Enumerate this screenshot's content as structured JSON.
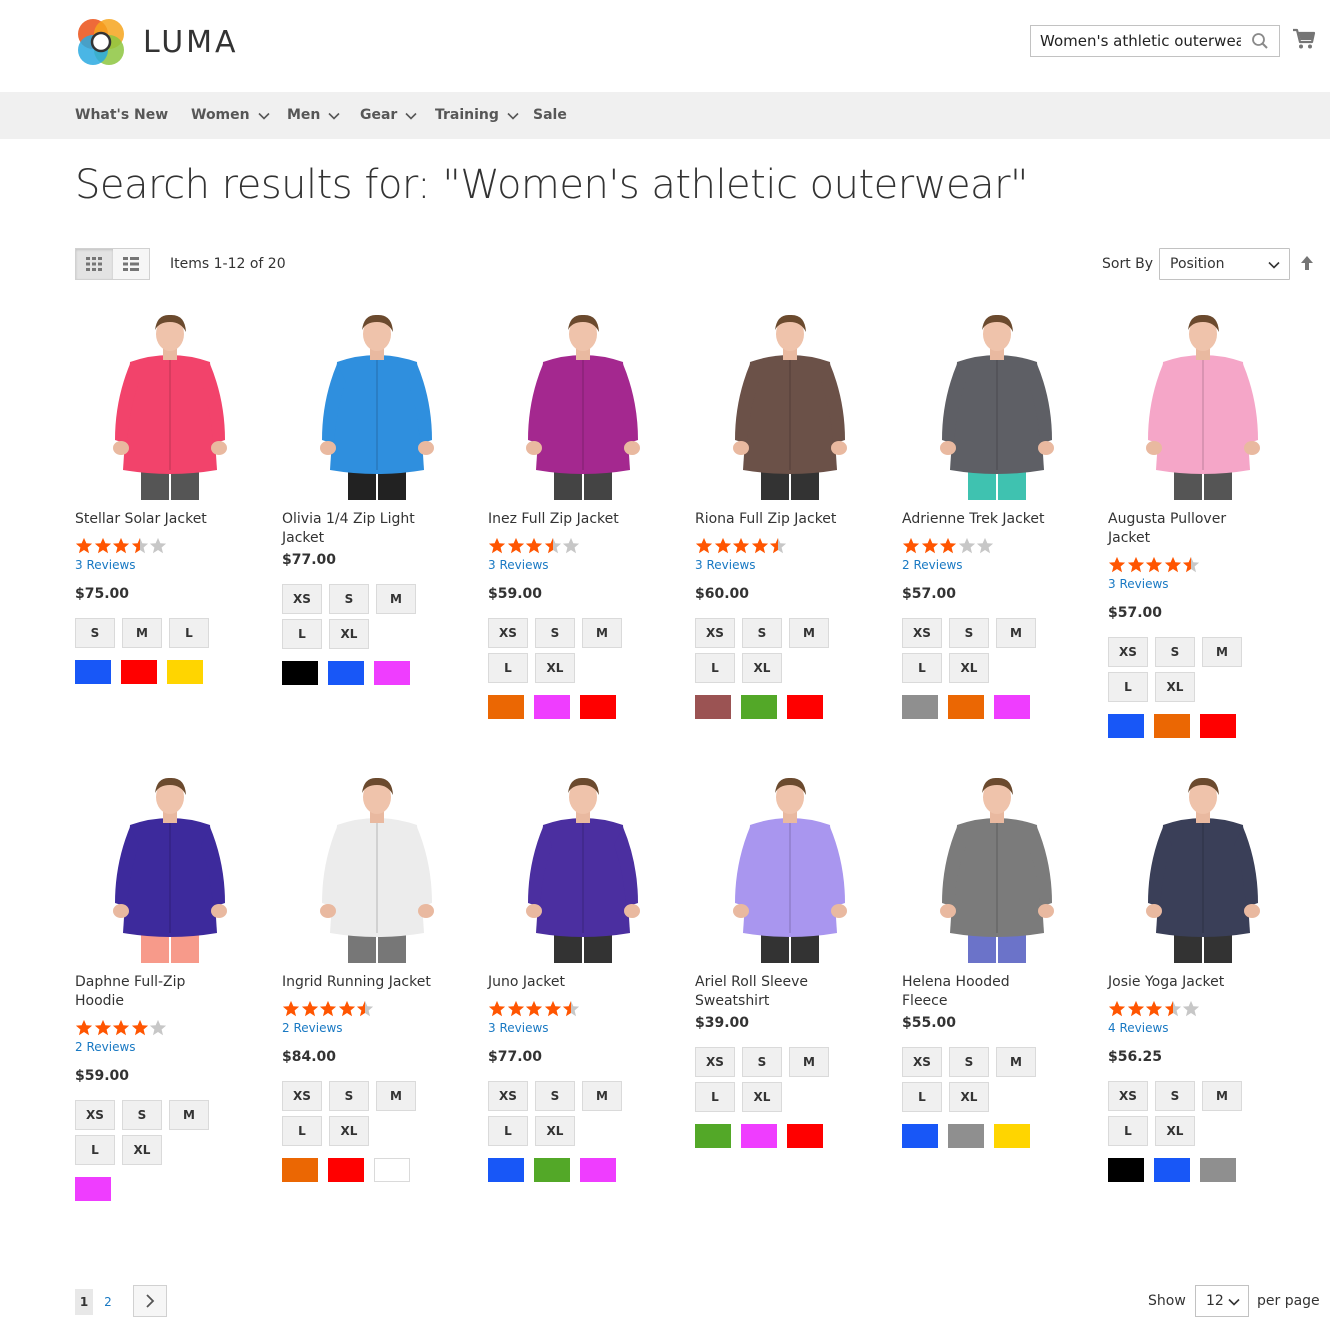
{
  "brand": {
    "name": "LUMA"
  },
  "search": {
    "value": "Women's athletic outerwear"
  },
  "nav": [
    {
      "label": "What's New",
      "has_dropdown": false
    },
    {
      "label": "Women",
      "has_dropdown": true
    },
    {
      "label": "Men",
      "has_dropdown": true
    },
    {
      "label": "Gear",
      "has_dropdown": true
    },
    {
      "label": "Training",
      "has_dropdown": true
    },
    {
      "label": "Sale",
      "has_dropdown": false
    }
  ],
  "page_title": "Search results for: \"Women's athletic outerwear\"",
  "toolbar": {
    "view_modes": [
      "grid",
      "list"
    ],
    "active_mode": "grid",
    "amount": "Items 1-12 of 20",
    "sort_label": "Sort By",
    "sort_value": "Position",
    "sort_direction": "ascending"
  },
  "colors": {
    "link": "#1979c3",
    "star": "#ff5501",
    "star_empty": "#c7c7c7"
  },
  "products": [
    {
      "name": "Stellar Solar Jacket",
      "rating": 3.5,
      "reviews": "3  Reviews",
      "price": "$75.00",
      "sizes": [
        "S",
        "M",
        "L"
      ],
      "swatches": [
        "#1857f7",
        "#ff0000",
        "#ffd500"
      ],
      "garment": "#f2436b",
      "pants": "#555555"
    },
    {
      "name": "Olivia 1/4 Zip Light Jacket",
      "rating": null,
      "reviews": "",
      "price": "$77.00",
      "sizes": [
        "XS",
        "S",
        "M",
        "L",
        "XL"
      ],
      "swatches": [
        "#000000",
        "#1857f7",
        "#ef3dff"
      ],
      "garment": "#2f8fde",
      "pants": "#222222"
    },
    {
      "name": "Inez Full Zip Jacket",
      "rating": 3.5,
      "reviews": "3  Reviews",
      "price": "$59.00",
      "sizes": [
        "XS",
        "S",
        "M",
        "L",
        "XL"
      ],
      "swatches": [
        "#eb6703",
        "#ef3dff",
        "#ff0000"
      ],
      "garment": "#a4288f",
      "pants": "#444444"
    },
    {
      "name": "Riona Full Zip Jacket",
      "rating": 4.5,
      "reviews": "3  Reviews",
      "price": "$60.00",
      "sizes": [
        "XS",
        "S",
        "M",
        "L",
        "XL"
      ],
      "swatches": [
        "#9b5353",
        "#53a828",
        "#ff0000"
      ],
      "garment": "#6b5148",
      "pants": "#333333"
    },
    {
      "name": "Adrienne Trek Jacket",
      "rating": 3,
      "reviews": "2  Reviews",
      "price": "$57.00",
      "sizes": [
        "XS",
        "S",
        "M",
        "L",
        "XL"
      ],
      "swatches": [
        "#8f8f8f",
        "#eb6703",
        "#ef3dff"
      ],
      "garment": "#5e5f65",
      "pants": "#3fc2b0"
    },
    {
      "name": "Augusta Pullover Jacket",
      "rating": 4.5,
      "reviews": "3  Reviews",
      "price": "$57.00",
      "sizes": [
        "XS",
        "S",
        "M",
        "L",
        "XL"
      ],
      "swatches": [
        "#1857f7",
        "#eb6703",
        "#ff0000"
      ],
      "garment": "#f5a6c8",
      "pants": "#555555"
    },
    {
      "name": "Daphne Full-Zip Hoodie",
      "rating": 4,
      "reviews": "2  Reviews",
      "price": "$59.00",
      "sizes": [
        "XS",
        "S",
        "M",
        "L",
        "XL"
      ],
      "swatches": [
        "#ef3dff"
      ],
      "garment": "#3d2a9c",
      "pants": "#f79a8a"
    },
    {
      "name": "Ingrid Running Jacket",
      "rating": 4.5,
      "reviews": "2  Reviews",
      "price": "$84.00",
      "sizes": [
        "XS",
        "S",
        "M",
        "L",
        "XL"
      ],
      "swatches": [
        "#eb6703",
        "#ff0000",
        "#ffffff"
      ],
      "garment": "#ececec",
      "pants": "#777777"
    },
    {
      "name": "Juno Jacket",
      "rating": 4.5,
      "reviews": "3  Reviews",
      "price": "$77.00",
      "sizes": [
        "XS",
        "S",
        "M",
        "L",
        "XL"
      ],
      "swatches": [
        "#1857f7",
        "#53a828",
        "#ef3dff"
      ],
      "garment": "#4b2fa0",
      "pants": "#333333"
    },
    {
      "name": "Ariel Roll Sleeve Sweatshirt",
      "rating": null,
      "reviews": "",
      "price": "$39.00",
      "sizes": [
        "XS",
        "S",
        "M",
        "L",
        "XL"
      ],
      "swatches": [
        "#53a828",
        "#ef3dff",
        "#ff0000"
      ],
      "garment": "#a996ef",
      "pants": "#333333"
    },
    {
      "name": "Helena Hooded Fleece",
      "rating": null,
      "reviews": "",
      "price": "$55.00",
      "sizes": [
        "XS",
        "S",
        "M",
        "L",
        "XL"
      ],
      "swatches": [
        "#1857f7",
        "#8f8f8f",
        "#ffd500"
      ],
      "garment": "#7b7b7b",
      "pants": "#6b73c9"
    },
    {
      "name": "Josie Yoga Jacket",
      "rating": 3.5,
      "reviews": "4  Reviews",
      "price": "$56.25",
      "sizes": [
        "XS",
        "S",
        "M",
        "L",
        "XL"
      ],
      "swatches": [
        "#000000",
        "#1857f7",
        "#8f8f8f"
      ],
      "garment": "#3a3f58",
      "pants": "#333333"
    }
  ],
  "pagination": {
    "current": "1",
    "pages": [
      "1",
      "2"
    ],
    "next_label": ">"
  },
  "limiter": {
    "show_label": "Show",
    "value": "12",
    "per_page_label": "per page"
  }
}
